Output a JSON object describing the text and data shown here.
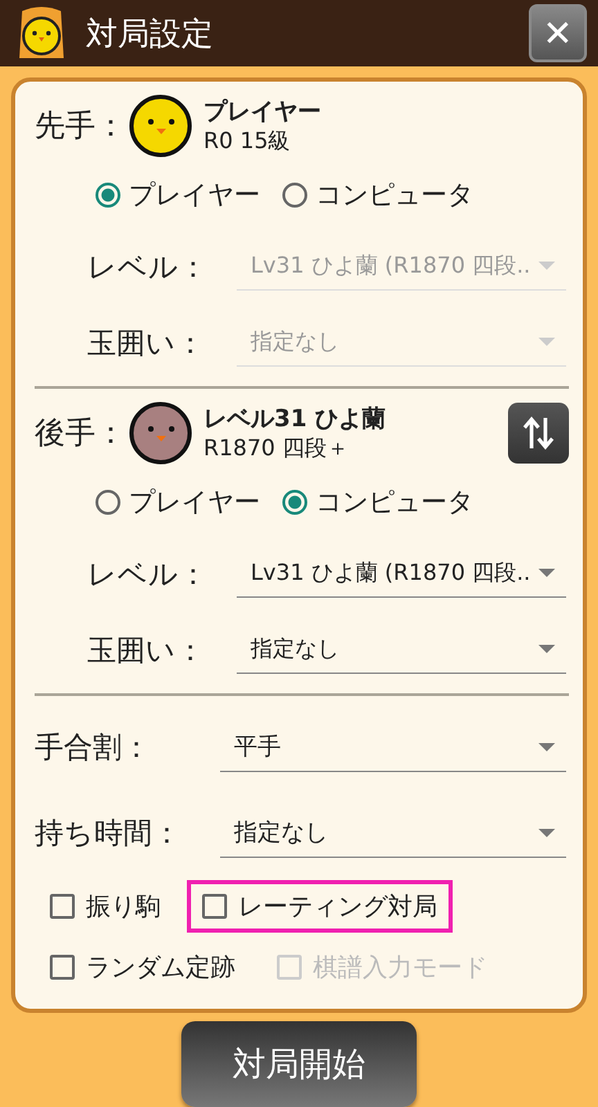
{
  "window": {
    "title": "対局設定",
    "close": "✕"
  },
  "players": [
    {
      "label": "先手：",
      "name": "プレイヤー",
      "rating": "R0 15級",
      "color": "#f5d800",
      "swap": false,
      "radios": [
        {
          "label": "プレイヤー",
          "selected": true
        },
        {
          "label": "コンピュータ",
          "selected": false
        }
      ],
      "fields": [
        {
          "label": "レベル：",
          "value": "Lv31 ひよ蘭 (R1870 四段..",
          "disabled": true
        },
        {
          "label": "玉囲い：",
          "value": "指定なし",
          "disabled": true
        }
      ]
    },
    {
      "label": "後手：",
      "name": "レベル31 ひよ蘭",
      "rating": "R1870 四段＋",
      "color": "#a88080",
      "swap": true,
      "radios": [
        {
          "label": "プレイヤー",
          "selected": false
        },
        {
          "label": "コンピュータ",
          "selected": true
        }
      ],
      "fields": [
        {
          "label": "レベル：",
          "value": "Lv31 ひよ蘭 (R1870 四段..",
          "disabled": false
        },
        {
          "label": "玉囲い：",
          "value": "指定なし",
          "disabled": false
        }
      ]
    }
  ],
  "game_fields": [
    {
      "label": "手合割：",
      "value": "平手"
    },
    {
      "label": "持ち時間：",
      "value": "指定なし"
    }
  ],
  "checkboxes": [
    [
      {
        "label": "振り駒",
        "checked": false,
        "disabled": false,
        "highlighted": false
      },
      {
        "label": "レーティング対局",
        "checked": false,
        "disabled": false,
        "highlighted": true
      }
    ],
    [
      {
        "label": "ランダム定跡",
        "checked": false,
        "disabled": false,
        "highlighted": false
      },
      {
        "label": "棋譜入力モード",
        "checked": false,
        "disabled": true,
        "highlighted": false
      }
    ]
  ],
  "start_button": "対局開始"
}
